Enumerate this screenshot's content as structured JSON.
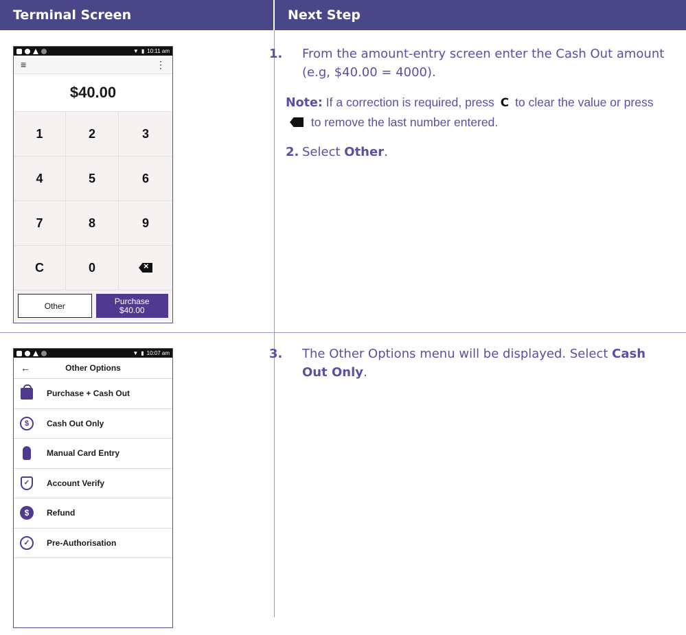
{
  "headers": {
    "left": "Terminal Screen",
    "right": "Next Step"
  },
  "colors": {
    "header_bg": "#4a4789",
    "text": "#5b4fa3",
    "button_purple": "#4f3a8f"
  },
  "phone1": {
    "status_time": "10:11 am",
    "amount": "$40.00",
    "keys": [
      "1",
      "2",
      "3",
      "4",
      "5",
      "6",
      "7",
      "8",
      "9",
      "C",
      "0",
      "backspace-icon"
    ],
    "other_label": "Other",
    "purchase_label": "Purchase",
    "purchase_amount": "$40.00"
  },
  "phone2": {
    "status_time": "10:07 am",
    "title": "Other Options",
    "items": [
      {
        "label": "Purchase + Cash Out",
        "icon": "shopping-bag-icon"
      },
      {
        "label": "Cash Out Only",
        "icon": "cash-out-icon"
      },
      {
        "label": "Manual Card Entry",
        "icon": "hand-pointer-icon"
      },
      {
        "label": "Account Verify",
        "icon": "shield-check-icon"
      },
      {
        "label": "Refund",
        "icon": "refund-icon"
      },
      {
        "label": "Pre-Authorisation",
        "icon": "clock-check-icon"
      }
    ]
  },
  "steps": {
    "s1_num": "1.",
    "s1_text": "From the amount-entry screen enter the Cash Out amount (e.g, $40.00 = 4000).",
    "note_label": "Note:",
    "note_part1": "If a correction is required, press",
    "note_c": "C",
    "note_part2": "to clear the value or press",
    "note_part3": "to remove the last number entered.",
    "s2_num": "2.",
    "s2_pre": "Select",
    "s2_bold": "Other",
    "s2_post": ".",
    "s3_num": "3.",
    "s3_text": "The Other Options menu will be displayed. Select",
    "s3_bold": "Cash Out Only",
    "s3_post": "."
  }
}
